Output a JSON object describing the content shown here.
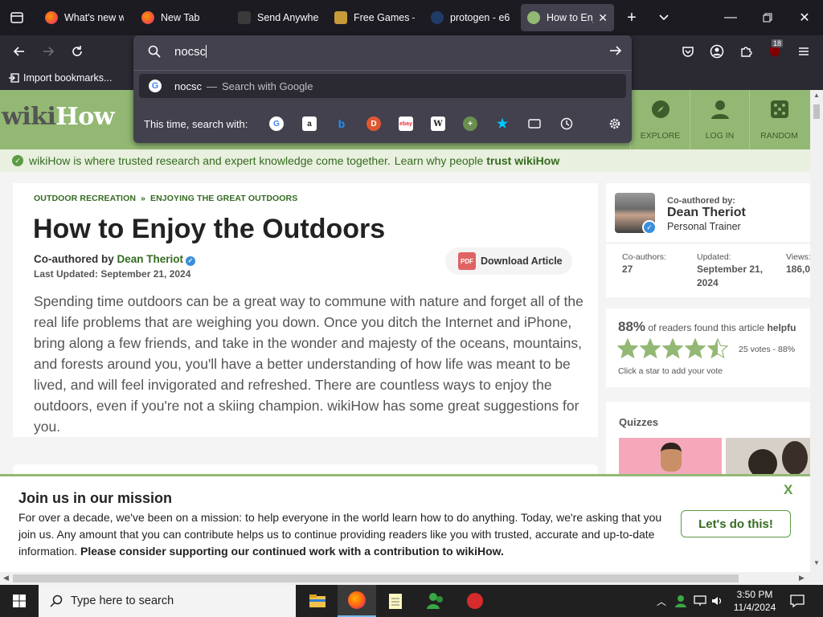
{
  "browser": {
    "tabs": [
      {
        "title": "What's new w",
        "favicon": "firefox-icon",
        "active": false
      },
      {
        "title": "New Tab",
        "favicon": "firefox-icon",
        "active": false
      },
      {
        "title": "Send Anywher",
        "favicon": "send-anywhere-icon",
        "active": false
      },
      {
        "title": "Free Games –",
        "favicon": "free-games-icon",
        "active": false
      },
      {
        "title": "protogen - e6",
        "favicon": "e621-icon",
        "active": false
      },
      {
        "title": "How to Enj",
        "favicon": "wikihow-icon",
        "active": true
      }
    ],
    "url_input": "nocsc",
    "suggestion": {
      "query": "nocsc",
      "separator": "—",
      "action": "Search with Google"
    },
    "search_with_label": "This time, search with:",
    "engines": [
      "google-icon",
      "amazon-icon",
      "bing-icon",
      "duckduckgo-icon",
      "ebay-icon",
      "wikipedia-icon",
      "add-engine-icon",
      "bookmarks-star-icon",
      "tabs-icon",
      "history-icon",
      "settings-gear-icon"
    ],
    "bookmarks": {
      "import_label": "Import bookmarks..."
    },
    "extension_badge": "18"
  },
  "wikihow": {
    "logo_wiki": "wiki",
    "logo_how": "How",
    "nav": [
      {
        "label": "EXPLORE",
        "icon": "compass-icon"
      },
      {
        "label": "LOG IN",
        "icon": "user-icon"
      },
      {
        "label": "RANDOM",
        "icon": "dice-icon"
      }
    ],
    "trust_text": "wikiHow is where trusted research and expert knowledge come together.",
    "trust_link_pre": "Learn why people",
    "trust_link_bold": "trust wikiHow",
    "breadcrumb": [
      "OUTDOOR RECREATION",
      "ENJOYING THE GREAT OUTDOORS"
    ],
    "breadcrumb_sep": "»",
    "title": "How to Enjoy the Outdoors",
    "coauthored_prefix": "Co-authored by",
    "author": "Dean Theriot",
    "last_updated": "Last Updated: September 21, 2024",
    "download_label": "Download Article",
    "pdf_label": "PDF",
    "intro": "Spending time outdoors can be a great way to commune with nature and forget all of the real life problems that are weighing you down. Once you ditch the Internet and iPhone, bring along a few friends, and take in the wonder and majesty of the oceans, mountains, and forests around you, you'll have a better understanding of how life was meant to be lived, and will feel invigorated and refreshed. There are countless ways to enjoy the outdoors, even if you're not a skiing champion. wikiHow has some great suggestions for you.",
    "sidebar": {
      "coauthored_by_label": "Co-authored by:",
      "name": "Dean Theriot",
      "role": "Personal Trainer",
      "stats": [
        {
          "label": "Co-authors:",
          "value": "27"
        },
        {
          "label": "Updated:",
          "value": "September 21, 2024"
        },
        {
          "label": "Views:",
          "value": "186,0"
        }
      ],
      "helpful_pct": "88%",
      "helpful_text": "of readers found this article",
      "helpful_bold": "helpfu",
      "rating": 4.5,
      "rating_max": 5,
      "votes": "25 votes - 88%",
      "click_star": "Click a star to add your vote",
      "quizzes": "Quizzes"
    },
    "mission": {
      "title": "Join us in our mission",
      "text": "For over a decade, we've been on a mission: to help everyone in the world learn how to do anything. Today, we're asking that you join us. Any amount that you can contribute helps us to continue providing readers like you with trusted, accurate and up-to-date information.",
      "bold": "Please consider supporting our continued work with a contribution to wikiHow.",
      "button": "Let's do this!",
      "close": "X"
    },
    "colors": {
      "brand_green": "#93b874",
      "link_green": "#346b20",
      "star": "#93b874"
    }
  },
  "taskbar": {
    "search_placeholder": "Type here to search",
    "time": "3:50 PM",
    "date": "11/4/2024"
  }
}
